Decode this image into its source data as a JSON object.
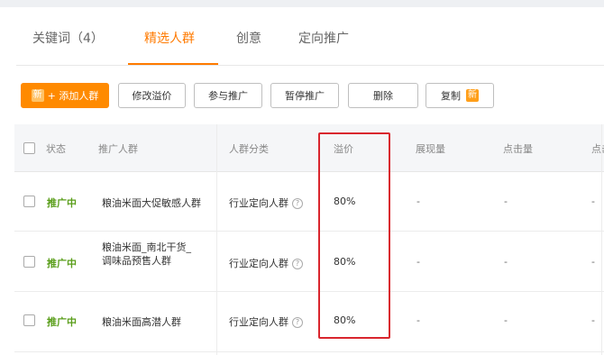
{
  "tabs": [
    {
      "label": "关键词（4）",
      "active": false
    },
    {
      "label": "精选人群",
      "active": true
    },
    {
      "label": "创意",
      "active": false
    },
    {
      "label": "定向推广",
      "active": false
    }
  ],
  "toolbar": {
    "add_badge": "新",
    "add_label": "+ 添加人群",
    "edit_premium": "修改溢价",
    "join_promo": "参与推广",
    "pause_promo": "暂停推广",
    "delete": "删除",
    "copy": "复制",
    "copy_badge": "新"
  },
  "table": {
    "headers": {
      "status": "状态",
      "crowd": "推广人群",
      "category": "人群分类",
      "premium": "溢价",
      "impressions": "展现量",
      "clicks": "点击量",
      "clickrate": "点击"
    },
    "rows": [
      {
        "status": "推广中",
        "crowd": "粮油米面大促敏感人群",
        "crowd2": "",
        "category": "行业定向人群",
        "premium": "80%",
        "impressions": "-",
        "clicks": "-",
        "extra": "-"
      },
      {
        "status": "推广中",
        "crowd": "粮油米面_南北干货_",
        "crowd2": "调味品预售人群",
        "category": "行业定向人群",
        "premium": "80%",
        "impressions": "-",
        "clicks": "-",
        "extra": "-"
      },
      {
        "status": "推广中",
        "crowd": "粮油米面高潜人群",
        "crowd2": "",
        "category": "行业定向人群",
        "premium": "80%",
        "impressions": "-",
        "clicks": "-",
        "extra": "-"
      }
    ]
  },
  "colors": {
    "accent": "#ff7a00",
    "status_green": "#5a9e1b",
    "highlight_red": "#d9262e"
  }
}
